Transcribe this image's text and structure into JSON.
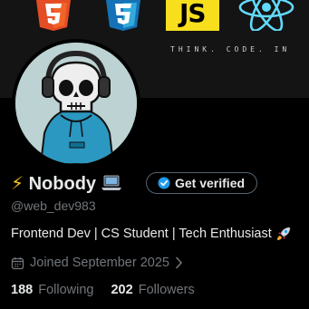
{
  "banner": {
    "logos": [
      "html5-logo",
      "css3-logo",
      "javascript-logo",
      "react-logo"
    ],
    "js_text": "JS",
    "tagline": "THINK. CODE. IN"
  },
  "profile": {
    "emoji_prefix": "⚡",
    "display_name": "Nobody",
    "verify_label": "Get verified",
    "handle": "@web_dev983",
    "bio": "Frontend Dev | CS Student | Tech Enthusiast",
    "joined": "Joined September 2025"
  },
  "stats": {
    "following_count": "188",
    "following_label": "Following",
    "followers_count": "202",
    "followers_label": "Followers"
  },
  "colors": {
    "background": "#000000",
    "text": "#e7e9ea",
    "muted": "#71767b",
    "verified_blue": "#1d9bf0",
    "avatar_bg": "#bcd2d3"
  }
}
